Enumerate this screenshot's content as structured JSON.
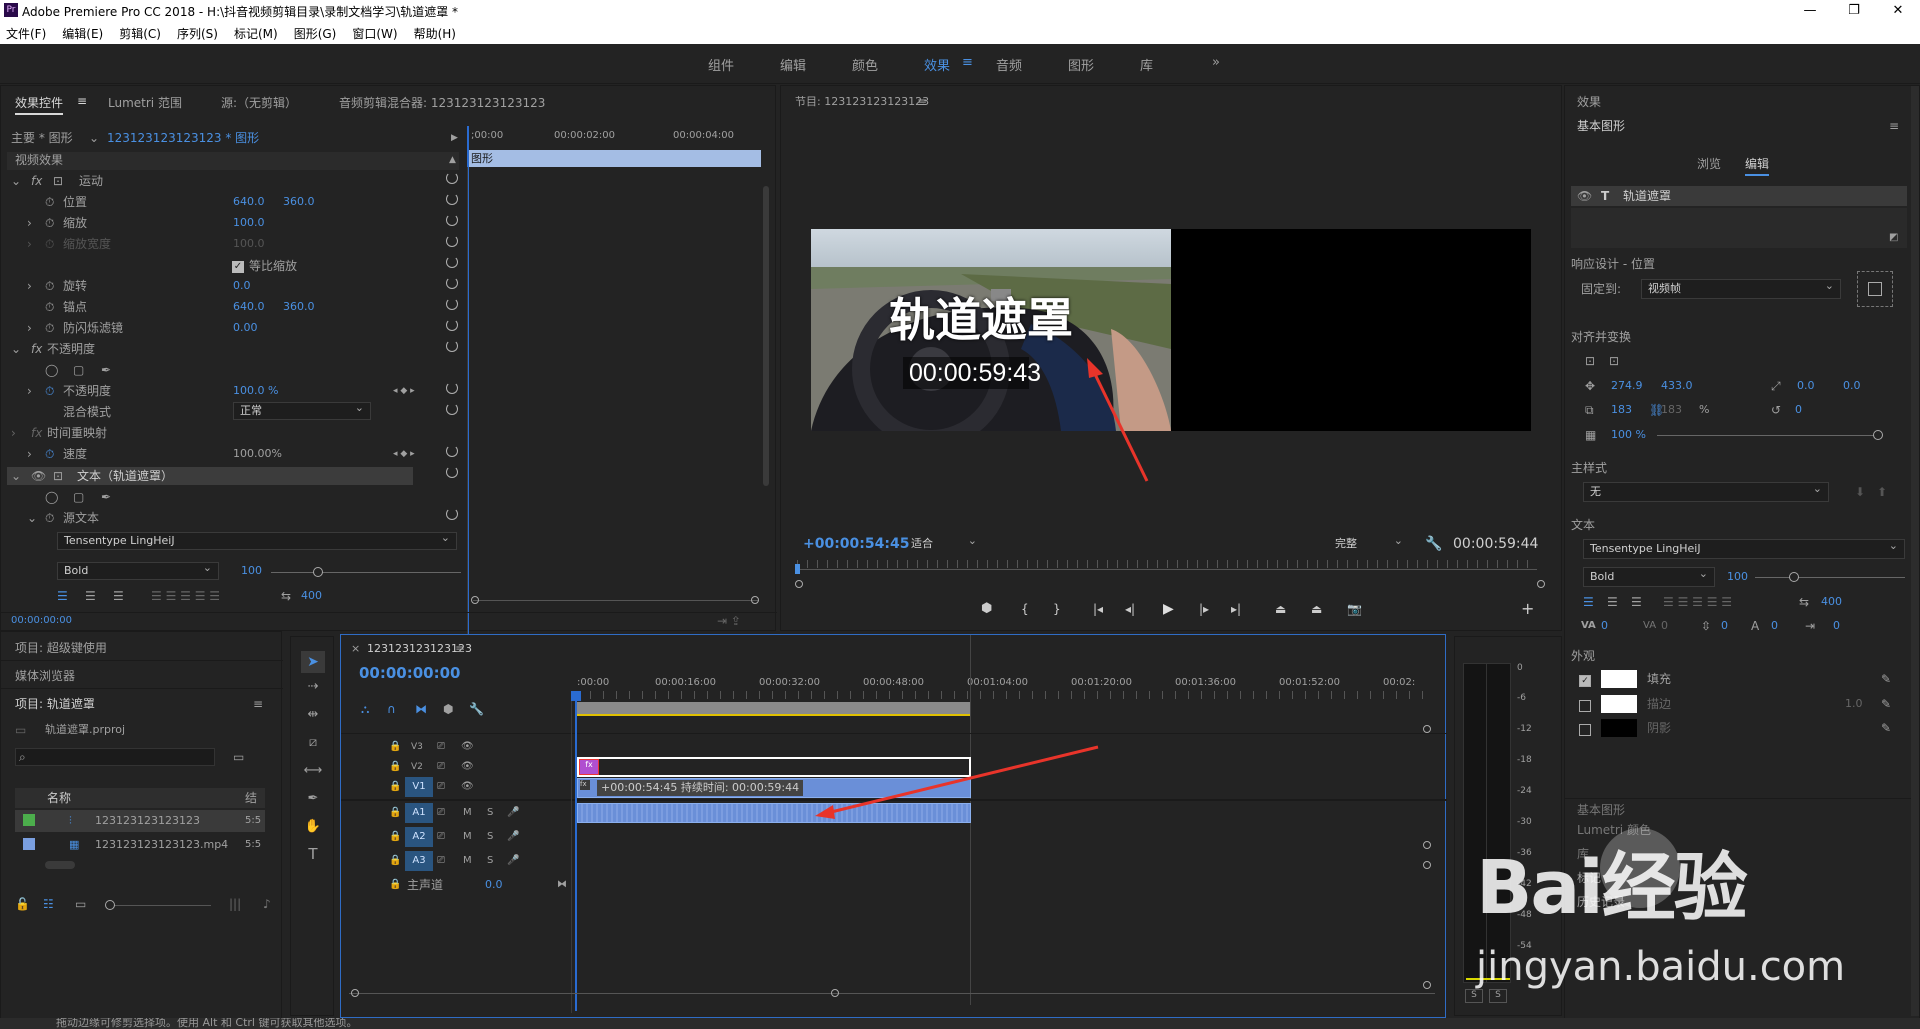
{
  "title": "Adobe Premiere Pro CC 2018 - H:\\抖音视频剪辑目录\\录制文档学习\\轨道遮罩 *",
  "menus": [
    "文件(F)",
    "编辑(E)",
    "剪辑(C)",
    "序列(S)",
    "标记(M)",
    "图形(G)",
    "窗口(W)",
    "帮助(H)"
  ],
  "workspaces": [
    "组件",
    "编辑",
    "颜色",
    "效果",
    "音频",
    "图形",
    "库"
  ],
  "effect_controls": {
    "tabs": [
      "效果控件",
      "Lumetri 范围",
      "源:（无剪辑）",
      "音频剪辑混合器: 123123123123123"
    ],
    "master": "主要 * 图形",
    "clip": "123123123123123 * 图形",
    "tc0": ";00:00",
    "tc1": "00:00:02:00",
    "tc2": "00:00:04:00",
    "clipbar": "图形",
    "video_effects": "视频效果",
    "motion": "运动",
    "position": "位置",
    "pos_x": "640.0",
    "pos_y": "360.0",
    "scale": "缩放",
    "scale_v": "100.0",
    "scale_w": "缩放宽度",
    "scale_w_v": "100.0",
    "uniform": "等比缩放",
    "rotation": "旋转",
    "rotation_v": "0.0",
    "anchor": "锚点",
    "anc_x": "640.0",
    "anc_y": "360.0",
    "flicker": "防闪烁滤镜",
    "flicker_v": "0.00",
    "opacity": "不透明度",
    "opacity_prop": "不透明度",
    "opacity_v": "100.0 %",
    "blend": "混合模式",
    "blend_v": "正常",
    "time_remap": "时间重映射",
    "speed": "速度",
    "speed_v": "100.00%",
    "text_layer": "文本（轨道遮罩）",
    "source_text": "源文本",
    "font": "Tensentype LingHeiJ",
    "style": "Bold",
    "size": "100",
    "tracking": "400",
    "timecode": "00:00:00:00"
  },
  "program": {
    "title": "节目: 123123123123123",
    "overlay_text": "轨道遮罩",
    "overlay_tc": "00:00:59:43",
    "tc_left": "+00:00:54:45",
    "fit": "适合",
    "quality": "完整",
    "tc_right": "00:00:59:44"
  },
  "project": {
    "t1": "项目: 超级键使用",
    "t2": "媒体浏览器",
    "t3": "项目: 轨道遮罩",
    "file": "轨道遮罩.prproj",
    "col_name": "名称",
    "col_x": "结",
    "items": [
      {
        "name": "123123123123123",
        "d": "5:5"
      },
      {
        "name": "123123123123123.mp4",
        "d": "5:5"
      }
    ]
  },
  "timeline": {
    "seq": "123123123123123",
    "tc": "00:00:00:00",
    "ruler": [
      ":00:00",
      "00:00:16:00",
      "00:00:32:00",
      "00:00:48:00",
      "00:01:04:00",
      "00:01:20:00",
      "00:01:36:00",
      "00:01:52:00",
      "00:02:"
    ],
    "tracks": [
      "V3",
      "V2",
      "V1",
      "A1",
      "A2",
      "A3"
    ],
    "master": "主声道",
    "master_v": "0.0",
    "tooltip": "+00:00:54:45 持续时间: 00:00:59:44"
  },
  "meter": {
    "ticks": [
      "0",
      "-6",
      "-12",
      "-18",
      "-24",
      "-30",
      "-36",
      "-42",
      "-48",
      "-54"
    ],
    "s1": "S",
    "s2": "S"
  },
  "egp": {
    "panel": "效果",
    "title": "基本图形",
    "tab_browse": "浏览",
    "tab_edit": "编辑",
    "layer": "轨道遮罩",
    "responsive": "响应设计 - 位置",
    "pin_label": "固定到:",
    "pin_v": "视频帧",
    "align": "对齐并变换",
    "px": "274.9",
    "py": "433.0",
    "ax": "0.0",
    "ay": "0.0",
    "sw": "183",
    "sh": "183",
    "pct": "%",
    "rot": "0",
    "op": "100 %",
    "master_style": "主样式",
    "master_style_v": "无",
    "text": "文本",
    "font": "Tensentype LingHeiJ",
    "style": "Bold",
    "size": "100",
    "tracking": "400",
    "v1": "0",
    "v2": "0",
    "v3": "0",
    "v4": "0",
    "v5": "0",
    "appearance": "外观",
    "fill": "填充",
    "stroke": "描边",
    "stroke_v": "1.0",
    "shadow": "阴影",
    "basic": "基本图形",
    "lumetri": "Lumetri 颜色",
    "lib": "库",
    "markers": "标记",
    "history": "历史记录"
  },
  "status": "拖动边缘可修剪选择项。使用 Alt 和 Ctrl 键可获取其他选项。",
  "watermark": {
    "brand": "Bai经验",
    "url": "jingyan.baidu.com"
  }
}
